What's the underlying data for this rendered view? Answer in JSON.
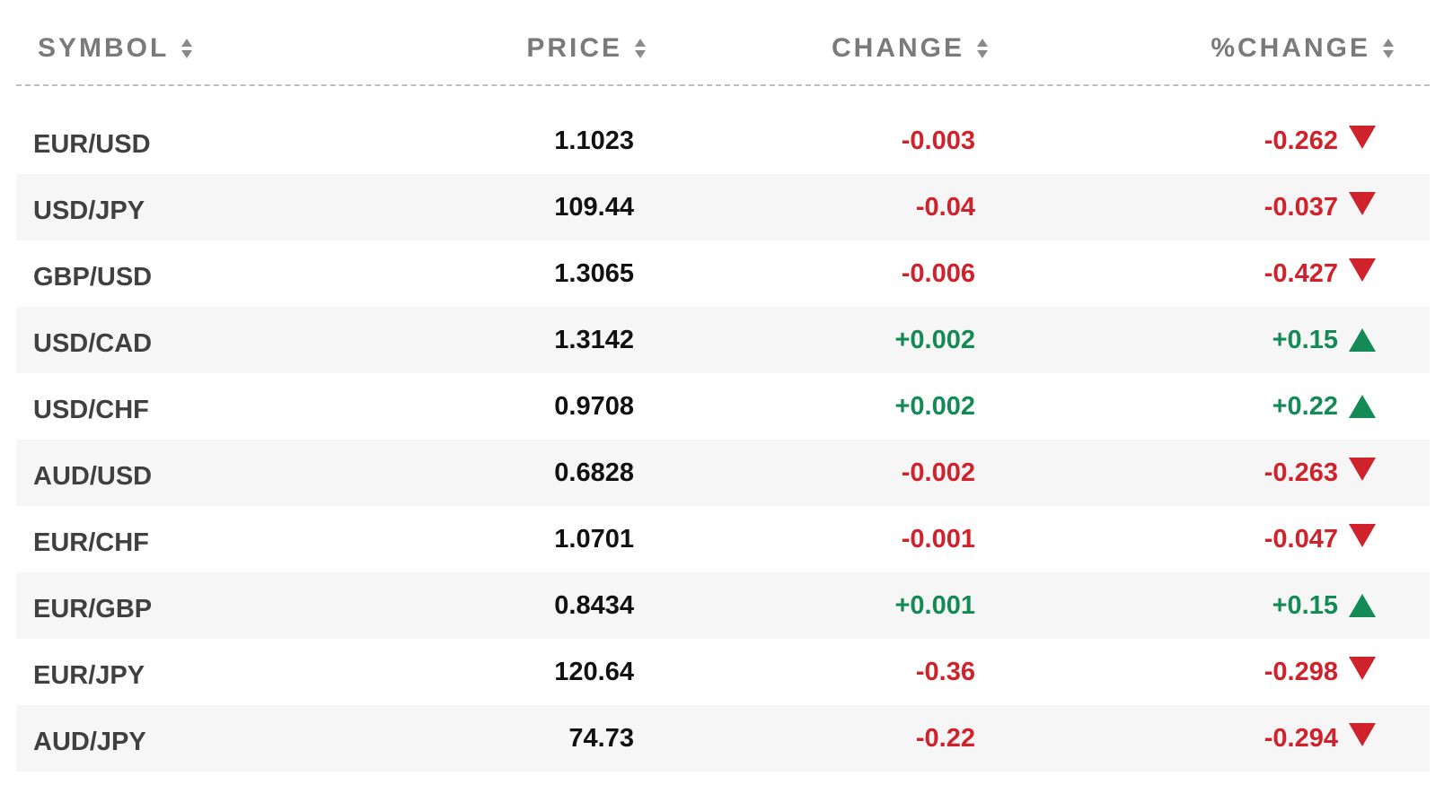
{
  "columns": {
    "symbol": "SYMBOL",
    "price": "PRICE",
    "change": "CHANGE",
    "pct_change": "%CHANGE"
  },
  "colors": {
    "negative": "#d0222b",
    "positive": "#148a57",
    "header_text": "#7a7a7a",
    "row_alt_bg": "#f6f6f6"
  },
  "rows": [
    {
      "symbol": "EUR/USD",
      "price": "1.1023",
      "change": "-0.003",
      "pct_change": "-0.262",
      "direction": "down"
    },
    {
      "symbol": "USD/JPY",
      "price": "109.44",
      "change": "-0.04",
      "pct_change": "-0.037",
      "direction": "down"
    },
    {
      "symbol": "GBP/USD",
      "price": "1.3065",
      "change": "-0.006",
      "pct_change": "-0.427",
      "direction": "down"
    },
    {
      "symbol": "USD/CAD",
      "price": "1.3142",
      "change": "+0.002",
      "pct_change": "+0.15",
      "direction": "up"
    },
    {
      "symbol": "USD/CHF",
      "price": "0.9708",
      "change": "+0.002",
      "pct_change": "+0.22",
      "direction": "up"
    },
    {
      "symbol": "AUD/USD",
      "price": "0.6828",
      "change": "-0.002",
      "pct_change": "-0.263",
      "direction": "down"
    },
    {
      "symbol": "EUR/CHF",
      "price": "1.0701",
      "change": "-0.001",
      "pct_change": "-0.047",
      "direction": "down"
    },
    {
      "symbol": "EUR/GBP",
      "price": "0.8434",
      "change": "+0.001",
      "pct_change": "+0.15",
      "direction": "up"
    },
    {
      "symbol": "EUR/JPY",
      "price": "120.64",
      "change": "-0.36",
      "pct_change": "-0.298",
      "direction": "down"
    },
    {
      "symbol": "AUD/JPY",
      "price": "74.73",
      "change": "-0.22",
      "pct_change": "-0.294",
      "direction": "down"
    }
  ]
}
